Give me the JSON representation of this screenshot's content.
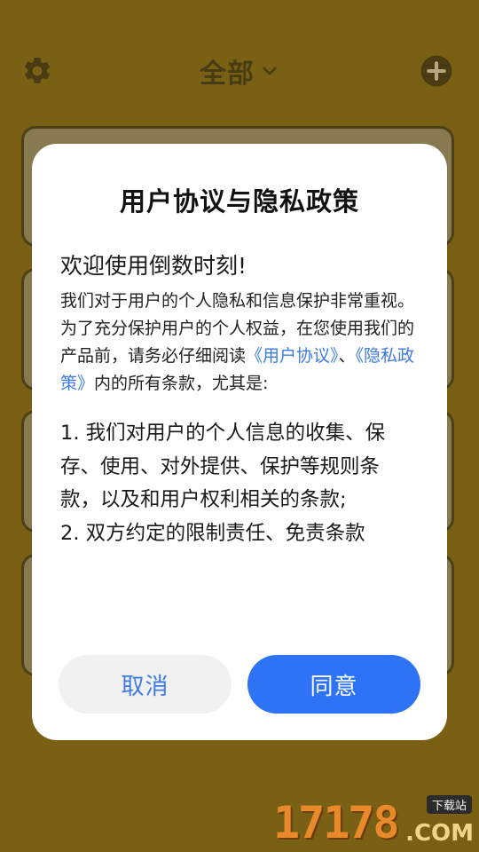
{
  "header": {
    "title": "全部"
  },
  "dialog": {
    "title": "用户协议与隐私政策",
    "subtitle": "欢迎使用倒数时刻!",
    "intro": {
      "part1": "我们对于用户的个人隐私和信息保护非常重视。为了充分保护用户的个人权益，在您使用我们的产品前，请务必仔细阅读",
      "link_user_agreement": "《用户协议》",
      "separator": "、",
      "link_privacy_policy": "《隐私政策》",
      "part2": "内的所有条款，尤其是:"
    },
    "terms": [
      "1. 我们对用户的个人信息的收集、保存、使用、对外提供、保护等规则条款，以及和用户权利相关的条款;",
      "2. 双方约定的限制责任、免责条款"
    ],
    "cancel_label": "取消",
    "agree_label": "同意"
  },
  "watermark": {
    "number": "17178",
    "domain": ".COM",
    "tag": "下载站"
  },
  "colors": {
    "background": "#7a6115",
    "link": "#3d7be6",
    "primary_button": "#2e73f5"
  },
  "icons": {
    "settings": "gear-icon",
    "title_dropdown": "chevron-down-icon",
    "add": "plus-circle-icon"
  }
}
